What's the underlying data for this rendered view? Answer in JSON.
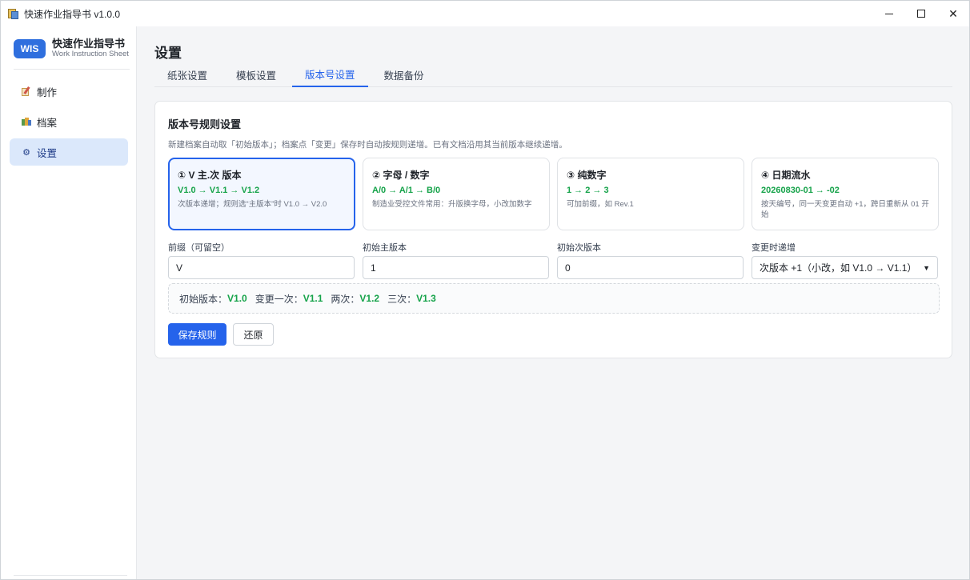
{
  "window": {
    "title": "快速作业指导书 v1.0.0",
    "controls": [
      "minimize",
      "maximize",
      "close"
    ]
  },
  "sidebar": {
    "logo": "WIS",
    "app_name": "快速作业指导书",
    "app_subtitle": "Work Instruction Sheet",
    "items": [
      {
        "label": "制作",
        "icon": "edit-icon",
        "active": false
      },
      {
        "label": "档案",
        "icon": "books-icon",
        "active": false
      },
      {
        "label": "设置",
        "icon": "gear-icon",
        "icon_glyph": "⚙",
        "active": true
      }
    ]
  },
  "main": {
    "title": "设置",
    "tabs": [
      {
        "label": "纸张设置",
        "active": false
      },
      {
        "label": "模板设置",
        "active": false
      },
      {
        "label": "版本号设置",
        "active": true
      },
      {
        "label": "数据备份",
        "active": false
      }
    ]
  },
  "rules": {
    "title": "版本号规则设置",
    "description": "新建档案自动取「初始版本」；档案点「变更」保存时自动按规则递增。已有文档沿用其当前版本继续递增。",
    "options": [
      {
        "title": "① V 主.次 版本",
        "example": "V1.0 → V1.1 → V1.2",
        "note": "次版本递增；规则选“主版本”时 V1.0 → V2.0",
        "selected": true
      },
      {
        "title": "② 字母 / 数字",
        "example": "A/0 → A/1 → B/0",
        "note": "制造业受控文件常用：升版换字母，小改加数字",
        "selected": false
      },
      {
        "title": "③ 纯数字",
        "example": "1 → 2 → 3",
        "note": "可加前缀，如 Rev.1",
        "selected": false
      },
      {
        "title": "④ 日期流水",
        "example": "20260830-01 → -02",
        "note": "按天编号，同一天变更自动 +1，跨日重新从 01 开始",
        "selected": false
      }
    ],
    "fields": {
      "prefix": {
        "label": "前缀（可留空）",
        "value": "V"
      },
      "initial_major": {
        "label": "初始主版本",
        "value": "1"
      },
      "initial_minor": {
        "label": "初始次版本",
        "value": "0"
      },
      "increment": {
        "label": "变更时递增",
        "value": "次版本 +1（小改，如 V1.0 → V1.1）"
      }
    },
    "preview": {
      "initial_label": "初始版本：",
      "initial_value": "V1.0",
      "first_label": "变更一次：",
      "first_value": "V1.1",
      "second_label": "两次：",
      "second_value": "V1.2",
      "third_label": "三次：",
      "third_value": "V1.3"
    },
    "buttons": {
      "save": "保存规则",
      "reset": "还原"
    }
  },
  "colors": {
    "accent": "#2563eb",
    "success": "#16a34a",
    "active_nav_bg": "#dbe8fb"
  }
}
